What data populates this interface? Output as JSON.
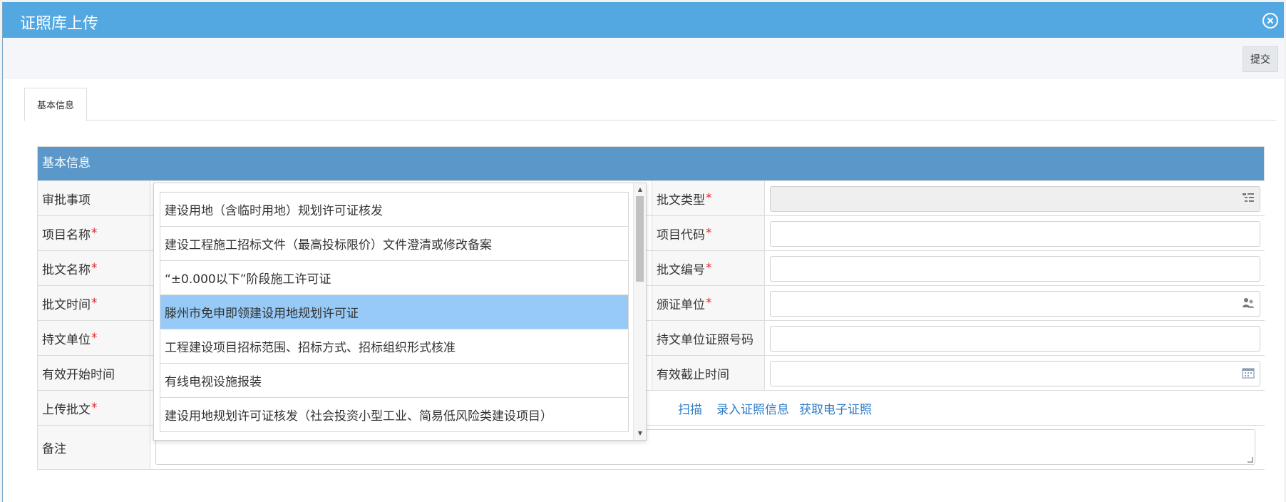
{
  "window": {
    "title": "证照库上传"
  },
  "toolbar": {
    "submit_label": "提交"
  },
  "tabs": [
    {
      "label": "基本信息"
    }
  ],
  "section": {
    "title": "基本信息"
  },
  "form": {
    "approval_item_label": "审批事项",
    "project_name_label": "项目名称",
    "doc_name_label": "批文名称",
    "doc_time_label": "批文时间",
    "holder_unit_label": "持文单位",
    "valid_start_label": "有效开始时间",
    "upload_label": "上传批文",
    "note_label": "备注",
    "doc_type_label": "批文类型",
    "project_code_label": "项目代码",
    "doc_no_label": "批文编号",
    "issuer_label": "颁证单位",
    "holder_cert_no_label": "持文单位证照号码",
    "valid_end_label": "有效截止时间",
    "required_mark": "*"
  },
  "actions": {
    "scan": "扫描",
    "enter_cert": "录入证照信息",
    "get_ecert": "获取电子证照"
  },
  "dropdown": {
    "items": [
      "建设用地（含临时用地）规划许可证核发",
      "建设工程施工招标文件（最高投标限价）文件澄清或修改备案",
      "“±0.000以下”阶段施工许可证",
      "滕州市免申即领建设用地规划许可证",
      "工程建设项目招标范围、招标方式、招标组织形式核准",
      "有线电视设施报装",
      "建设用地规划许可证核发（社会投资小型工业、简易低风险类建设项目）"
    ],
    "selected": "滕州市免申即领建设用地规划许可证"
  },
  "icons": {
    "close": "close-icon",
    "tree_select": "tree-list-icon",
    "users": "users-icon",
    "calendar": "calendar-icon"
  },
  "colors": {
    "titlebar": "#53a8e1",
    "section_header": "#5b97c9",
    "selected": "#97caf7",
    "required": "#e0252a",
    "link": "#2d7dc6"
  }
}
